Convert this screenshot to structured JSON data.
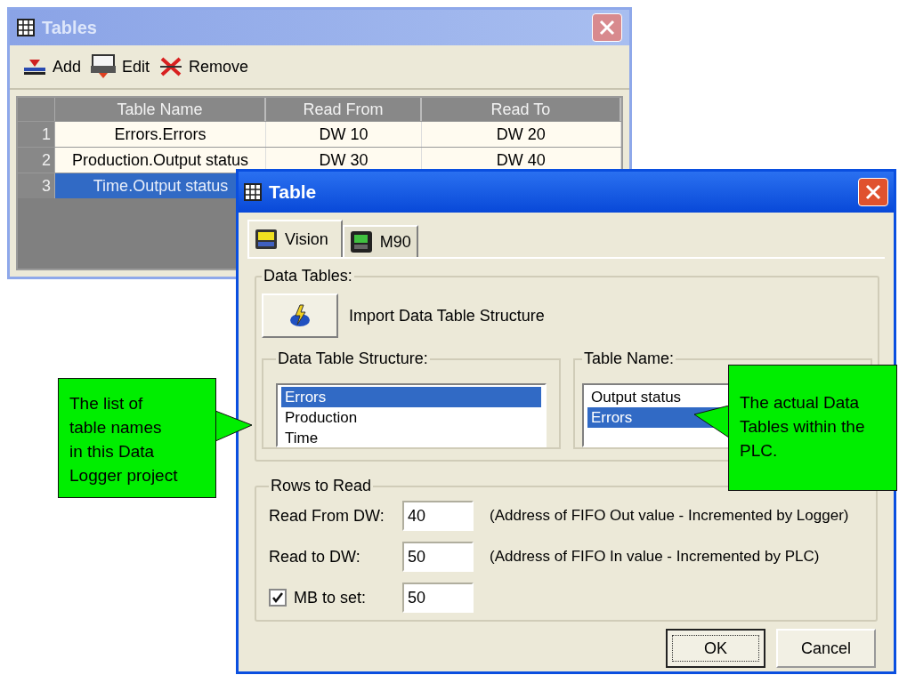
{
  "tables_window": {
    "title": "Tables",
    "toolbar": [
      {
        "kind": "add",
        "label": "Add"
      },
      {
        "kind": "edit",
        "label": "Edit"
      },
      {
        "kind": "remove",
        "label": "Remove"
      }
    ],
    "columns": [
      "Table Name",
      "Read From",
      "Read To"
    ],
    "rows": [
      {
        "number": "1",
        "cells": [
          "Errors.Errors",
          "DW 10",
          "DW 20"
        ],
        "selected": false
      },
      {
        "number": "2",
        "cells": [
          "Production.Output status",
          "DW 30",
          "DW 40"
        ],
        "selected": false
      },
      {
        "number": "3",
        "cells": [
          "Time.Output status"
        ],
        "selected": true
      }
    ]
  },
  "table_dialog": {
    "title": "Table",
    "tabs": [
      {
        "kind": "vision",
        "label": "Vision",
        "selected": true
      },
      {
        "kind": "m90",
        "label": "M90",
        "selected": false
      }
    ],
    "data_tables": {
      "legend": "Data Tables:",
      "import_label": "Import Data Table Structure",
      "structure": {
        "legend": "Data Table Structure:",
        "items": [
          {
            "label": "Errors",
            "selected": true
          },
          {
            "label": "Production",
            "selected": false
          },
          {
            "label": "Time",
            "selected": false
          }
        ]
      },
      "table_name": {
        "legend": "Table Name:",
        "items": [
          {
            "label": "Output status",
            "selected": false
          },
          {
            "label": "Errors",
            "selected": true
          }
        ]
      }
    },
    "rows_to_read": {
      "legend": "Rows to Read",
      "fields": [
        {
          "kind": "text",
          "label": "Read From DW:",
          "value": "40",
          "note": "(Address of FIFO Out value - Incremented by Logger)"
        },
        {
          "kind": "text",
          "label": "Read to DW:",
          "value": "50",
          "note": "(Address of FIFO In value - Incremented by PLC)"
        },
        {
          "kind": "checkbox",
          "label": "MB to set:",
          "checked": true,
          "value": "50"
        }
      ]
    },
    "buttons": [
      {
        "label": "OK",
        "default": true
      },
      {
        "label": "Cancel",
        "default": false
      }
    ]
  },
  "callouts": [
    {
      "lines": [
        "The list of",
        "table names",
        "in this Data",
        "Logger project"
      ]
    },
    {
      "lines": [
        "The actual Data",
        "Tables within the",
        "PLC."
      ]
    }
  ]
}
